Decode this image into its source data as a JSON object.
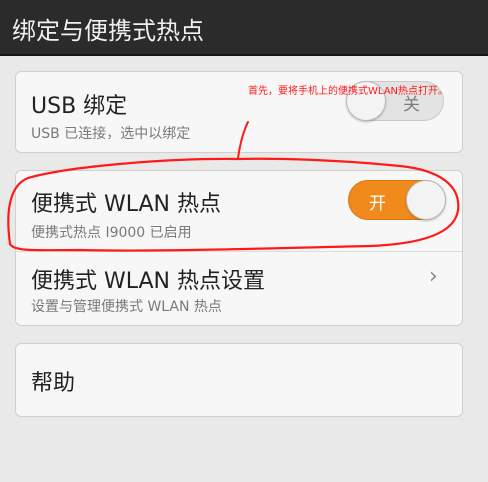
{
  "header": {
    "title": "绑定与便携式热点"
  },
  "usb_tether": {
    "label": "USB 绑定",
    "subtitle": "USB 已连接，选中以绑定",
    "toggle_text": "关",
    "enabled": false
  },
  "hotspot": {
    "label": "便携式 WLAN 热点",
    "subtitle": "便携式热点 I9000 已启用",
    "toggle_text": "开",
    "enabled": true
  },
  "hotspot_settings": {
    "label": "便携式 WLAN 热点设置",
    "subtitle": "设置与管理便携式 WLAN 热点",
    "chevron": "›"
  },
  "help": {
    "label": "帮助"
  },
  "annotation": {
    "text": "首先，要将手机上的便携式WLAN热点打开。"
  },
  "colors": {
    "header_bg": "#2b2b2b",
    "accent": "#f08a1c",
    "annotation_red": "#ff1a1a"
  },
  "icons": {
    "chevron": "chevron-right-icon"
  }
}
